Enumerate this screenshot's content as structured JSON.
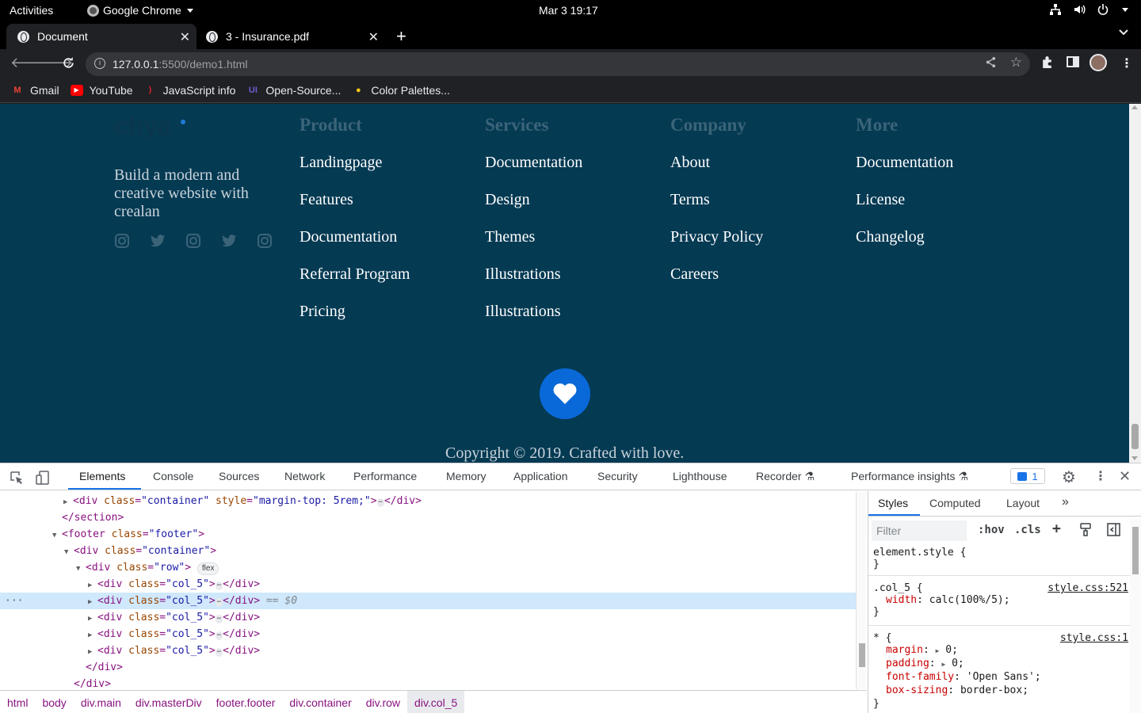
{
  "os": {
    "activities": "Activities",
    "app_name": "Google Chrome",
    "clock": "Mar 3  19:17"
  },
  "tabs": [
    {
      "title": "Document",
      "active": true
    },
    {
      "title": "3 - Insurance.pdf",
      "active": false
    }
  ],
  "toolbar": {
    "url_host": "127.0.0.1",
    "url_path": ":5500/demo1.html"
  },
  "bookmarks": [
    {
      "label": "Gmail",
      "icon": "gmail-icon",
      "color": "#ea4335"
    },
    {
      "label": "YouTube",
      "icon": "youtube-icon",
      "color": "#ff0000"
    },
    {
      "label": "JavaScript info",
      "icon": "javascript-info-icon",
      "color": "#dd1f26"
    },
    {
      "label": "Open-Source...",
      "icon": "ui-icon",
      "color": "#6f5bd6"
    },
    {
      "label": "Color Palettes...",
      "icon": "palette-icon",
      "color": "#f5c518"
    }
  ],
  "page": {
    "logo": "chya",
    "tagline": "Build a modern and creative website with crealan",
    "columns": [
      {
        "heading": "Product",
        "links": [
          "Landingpage",
          "Features",
          "Documentation",
          "Referral Program",
          "Pricing"
        ]
      },
      {
        "heading": "Services",
        "links": [
          "Documentation",
          "Design",
          "Themes",
          "Illustrations",
          "Illustrations"
        ]
      },
      {
        "heading": "Company",
        "links": [
          "About",
          "Terms",
          "Privacy Policy",
          "Careers"
        ]
      },
      {
        "heading": "More",
        "links": [
          "Documentation",
          "License",
          "Changelog"
        ]
      }
    ],
    "social_icons": [
      "instagram-icon",
      "twitter-icon",
      "instagram-icon",
      "twitter-icon",
      "instagram-icon"
    ],
    "copyright": "Copyright © 2019. Crafted with love.",
    "colors": {
      "background": "#053a53",
      "heart_button": "#0a69d8"
    }
  },
  "devtools": {
    "tabs": [
      "Elements",
      "Console",
      "Sources",
      "Network",
      "Performance",
      "Memory",
      "Application",
      "Security",
      "Lighthouse",
      "Recorder",
      "Performance insights"
    ],
    "active_tab": "Elements",
    "issues_count": "1",
    "dom": {
      "l1_tag": "<div",
      "l1_attr1": "class",
      "l1_val1": "\"container\"",
      "l1_attr2": "style",
      "l1_val2": "\"margin-top: 5rem;\"",
      "l1_close": "</div>",
      "l2": "</section>",
      "l3_tag": "<footer",
      "l3_attr": "class",
      "l3_val": "\"footer\"",
      "l4_val": "\"container\"",
      "l5_val": "\"row\"",
      "l5_pill": "flex",
      "col_val": "\"col_5\"",
      "eq0": "== $0",
      "l11": "</div>",
      "l12": "</div>",
      "div_open": "<div",
      "class_attr": "class",
      "gt": ">",
      "eq": "=",
      "ell": "⋯",
      "div_close": "</div>"
    },
    "breadcrumbs": [
      "html",
      "body",
      "div.main",
      "div.masterDiv",
      "footer.footer",
      "div.container",
      "div.row",
      "div.col_5"
    ],
    "styles": {
      "tabs": [
        "Styles",
        "Computed",
        "Layout"
      ],
      "filter_placeholder": "Filter",
      "hov": ":hov",
      "cls": ".cls",
      "element_style": "element.style {",
      "close_brace": "}",
      "rule1_selector": ".col_5 {",
      "rule1_source": "style.css:521",
      "rule1_prop": "width",
      "rule1_value": "calc(100%/5);",
      "rule2_selector": "* {",
      "rule2_source": "style.css:1",
      "rule2_props": [
        {
          "name": "margin",
          "value": "0;"
        },
        {
          "name": "padding",
          "value": "0;"
        },
        {
          "name": "font-family",
          "value": "'Open Sans';"
        },
        {
          "name": "box-sizing",
          "value": "border-box;"
        }
      ]
    }
  }
}
